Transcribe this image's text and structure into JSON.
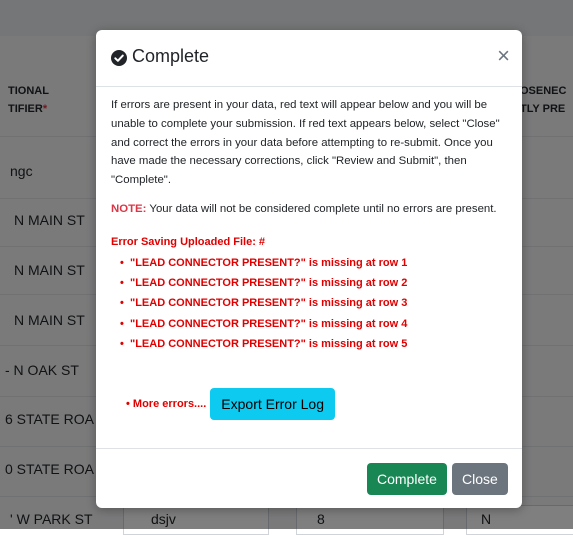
{
  "background": {
    "header_left_line1": "TIONAL",
    "header_left_line2": "TIFIER",
    "header_required_mark": "*",
    "header_right_line1": "OSENEC",
    "header_right_line2": "TLY PRE",
    "rows": [
      {
        "col1": "ngc"
      },
      {
        "col1": "N MAIN ST"
      },
      {
        "col1": "N MAIN ST"
      },
      {
        "col1": "N MAIN ST"
      },
      {
        "col1": "- N OAK ST"
      },
      {
        "col1": "6 STATE ROA"
      },
      {
        "col1": "0 STATE ROA"
      },
      {
        "col1": "' W PARK ST",
        "col2": "dsjv",
        "col3": "8",
        "col4": "N"
      }
    ]
  },
  "modal": {
    "title": "Complete",
    "close_glyph": "×",
    "paragraph": "If errors are present in your data, red text will appear below and you will be unable to complete your submission. If red text appears below, select \"Close\" and correct the errors in your data before attempting to re-submit. Once you have made the necessary corrections, click \"Review and Submit\", then \"Complete\".",
    "note_label": "NOTE:",
    "note_text": " Your data will not be considered complete until no errors are present.",
    "error_title": "Error Saving Uploaded File: #",
    "errors": [
      "\"LEAD CONNECTOR PRESENT?\" is missing at row 1",
      "\"LEAD CONNECTOR PRESENT?\" is missing at row 2",
      "\"LEAD CONNECTOR PRESENT?\" is missing at row 3",
      "\"LEAD CONNECTOR PRESENT?\" is missing at row 4",
      "\"LEAD CONNECTOR PRESENT?\" is missing at row 5"
    ],
    "more_errors": "More errors....",
    "export_button": "Export Error Log",
    "complete_button": "Complete",
    "close_button": "Close"
  },
  "colors": {
    "error_red": "#e00000",
    "complete_green": "#198754",
    "export_cyan": "#0dcaf0",
    "close_gray": "#6c757d"
  },
  "icons": {
    "title_icon": "check-circle-icon",
    "close_icon": "close-icon"
  }
}
